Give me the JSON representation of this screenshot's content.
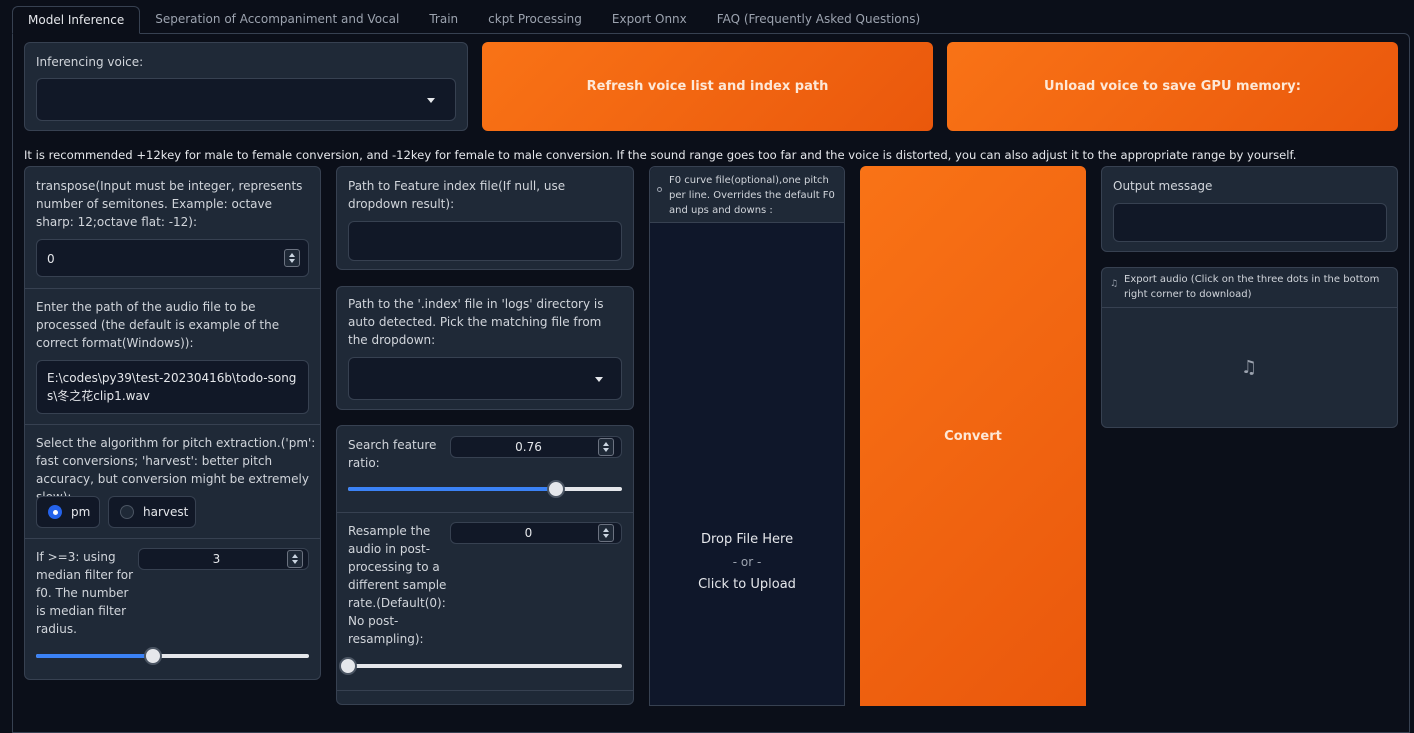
{
  "tabs": [
    {
      "label": "Model Inference"
    },
    {
      "label": "Seperation of Accompaniment and Vocal"
    },
    {
      "label": "Train"
    },
    {
      "label": "ckpt Processing"
    },
    {
      "label": "Export Onnx"
    },
    {
      "label": "FAQ (Frequently Asked Questions)"
    }
  ],
  "voice": {
    "label": "Inferencing voice:",
    "value": ""
  },
  "buttons": {
    "refresh": "Refresh voice list and index path",
    "unload": "Unload voice to save GPU memory:",
    "convert": "Convert"
  },
  "recommendation": "It is recommended +12key for male to female conversion, and -12key for female to male conversion. If the sound range goes too far and the voice is distorted, you can also adjust it to the appropriate range by yourself.",
  "transpose": {
    "label": "transpose(Input must be integer, represents number of semitones. Example: octave sharp: 12;octave flat: -12):",
    "value": "0"
  },
  "audio_path": {
    "label": "Enter the path of the audio file to be processed (the default is example of the correct format(Windows)):",
    "value": "E:\\codes\\py39\\test-20230416b\\todo-songs\\冬之花clip1.wav"
  },
  "pitch_algo": {
    "label": "Select the algorithm for pitch extraction.('pm': fast conversions; 'harvest': better pitch accuracy, but conversion might be extremely slow):",
    "options": [
      "pm",
      "harvest"
    ],
    "selected": "pm"
  },
  "median_filter": {
    "label": "If >=3: using median filter for f0. The number is median filter radius.",
    "value": "3",
    "fraction": 0.43
  },
  "feature_index": {
    "label": "Path to Feature index file(If null, use dropdown result):",
    "value": ""
  },
  "index_dropdown": {
    "label": "Path to the '.index' file in 'logs' directory is auto detected. Pick the matching file from the dropdown:",
    "value": ""
  },
  "search_ratio": {
    "label": "Search feature ratio:",
    "value": "0.76",
    "fraction": 0.76
  },
  "resample": {
    "label": "Resample the audio in post-processing to a different sample rate.(Default(0): No post-resampling):",
    "value": "0",
    "fraction": 0.0
  },
  "f0_file": {
    "label": "F0 curve file(optional),one pitch per line. Overrides the default F0 and ups and downs :"
  },
  "upload": {
    "drop": "Drop File Here",
    "or": "- or -",
    "click": "Click to Upload"
  },
  "output_message": {
    "label": "Output message",
    "value": ""
  },
  "export_audio": {
    "label": "Export audio (Click on the three dots in the bottom right corner to download)",
    "icon": "music-note-icon"
  },
  "colors": {
    "accent": "#f97316",
    "slider": "#3b82f6",
    "background": "#0b0f19",
    "panel": "#1f2937"
  }
}
